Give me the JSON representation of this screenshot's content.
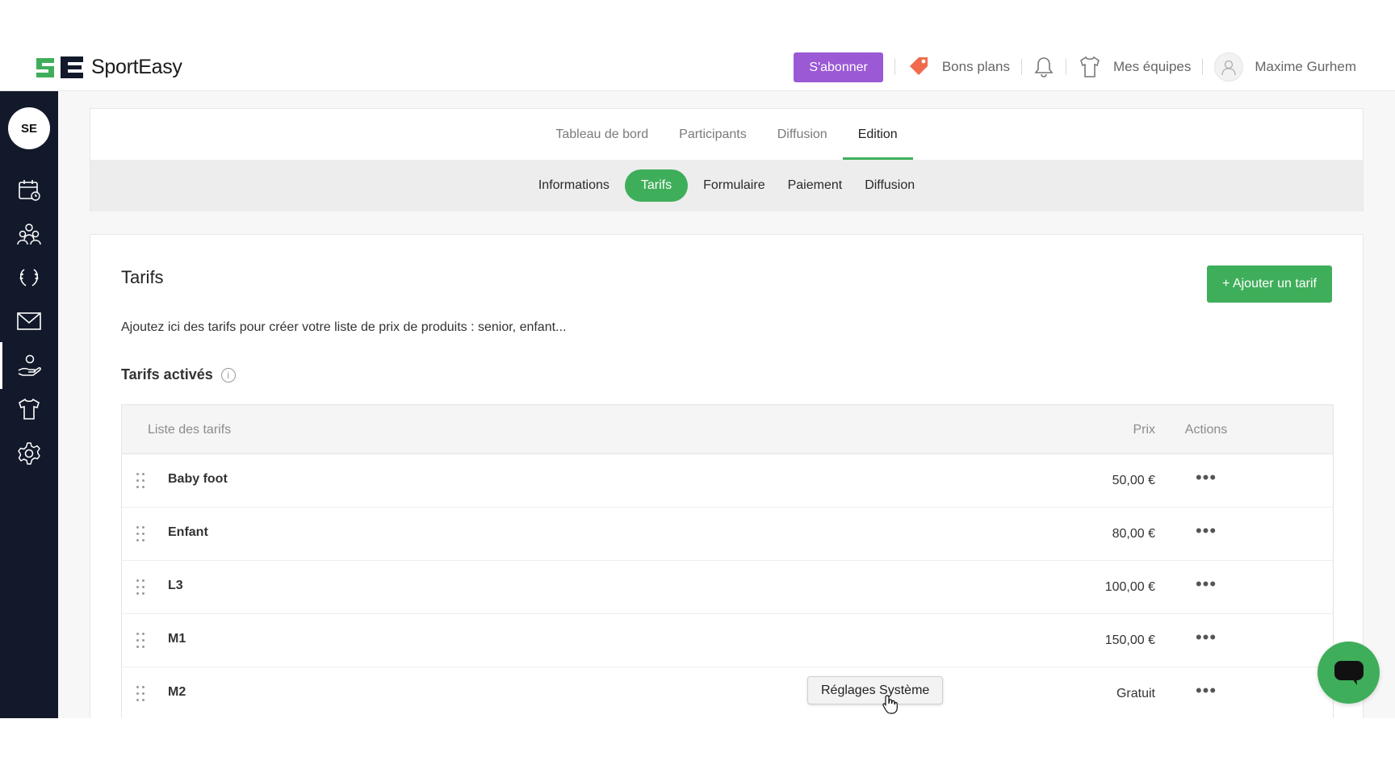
{
  "brand": {
    "name": "SportEasy",
    "accent": "#3fae5a",
    "subscribe_color": "#9b59d6",
    "sidebar_bg": "#12192b"
  },
  "header": {
    "subscribe_label": "S'abonner",
    "deals_label": "Bons plans",
    "teams_label": "Mes équipes",
    "user_name": "Maxime Gurhem"
  },
  "sidebar": {
    "club_logo_text": "SE",
    "items": [
      {
        "icon": "calendar-icon"
      },
      {
        "icon": "members-icon"
      },
      {
        "icon": "trophy-laurel-icon"
      },
      {
        "icon": "mail-icon"
      },
      {
        "icon": "hand-user-icon",
        "active": true
      },
      {
        "icon": "shirt-icon"
      },
      {
        "icon": "settings-gear-icon"
      }
    ]
  },
  "tabs": {
    "main": [
      "Tableau de bord",
      "Participants",
      "Diffusion",
      "Edition"
    ],
    "main_active": "Edition",
    "sub": [
      "Informations",
      "Tarifs",
      "Formulaire",
      "Paiement",
      "Diffusion"
    ],
    "sub_active": "Tarifs"
  },
  "content": {
    "title": "Tarifs",
    "add_button": "+ Ajouter un tarif",
    "description": "Ajoutez ici des tarifs pour créer votre liste de prix de produits : senior, enfant...",
    "section_title": "Tarifs activés",
    "table": {
      "headers": {
        "name": "Liste des tarifs",
        "price": "Prix",
        "actions": "Actions"
      },
      "rows": [
        {
          "name": "Baby foot",
          "price": "50,00 €"
        },
        {
          "name": "Enfant",
          "price": "80,00 €"
        },
        {
          "name": "L3",
          "price": "100,00 €"
        },
        {
          "name": "M1",
          "price": "150,00 €"
        },
        {
          "name": "M2",
          "price": "Gratuit"
        }
      ],
      "actions_glyph": "•••"
    }
  },
  "tooltip": {
    "text": "Réglages Système"
  }
}
